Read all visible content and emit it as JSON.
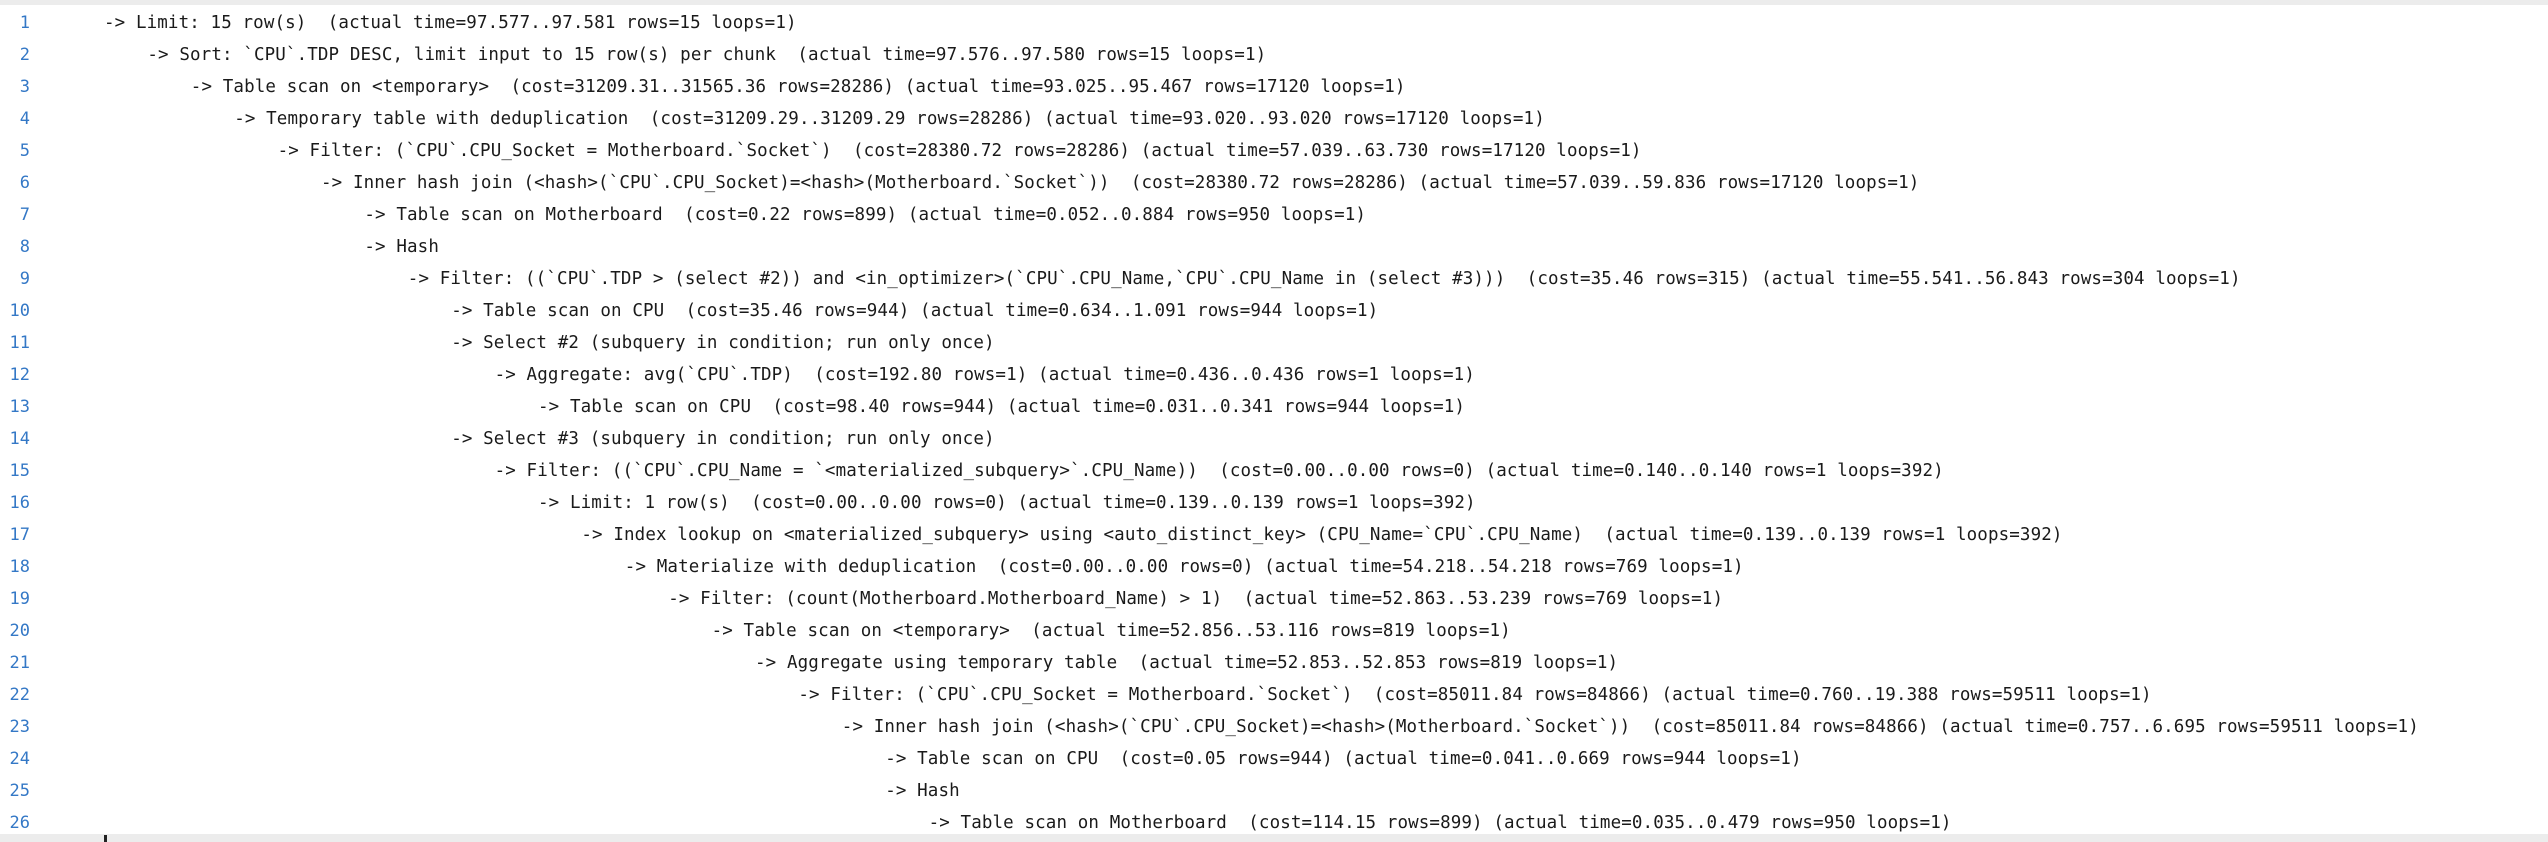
{
  "editor": {
    "lines": [
      {
        "number": "1",
        "indent": 0,
        "text": "-> Limit: 15 row(s)  (actual time=97.577..97.581 rows=15 loops=1)"
      },
      {
        "number": "2",
        "indent": 1,
        "text": "-> Sort: `CPU`.TDP DESC, limit input to 15 row(s) per chunk  (actual time=97.576..97.580 rows=15 loops=1)"
      },
      {
        "number": "3",
        "indent": 2,
        "text": "-> Table scan on <temporary>  (cost=31209.31..31565.36 rows=28286) (actual time=93.025..95.467 rows=17120 loops=1)"
      },
      {
        "number": "4",
        "indent": 3,
        "text": "-> Temporary table with deduplication  (cost=31209.29..31209.29 rows=28286) (actual time=93.020..93.020 rows=17120 loops=1)"
      },
      {
        "number": "5",
        "indent": 4,
        "text": "-> Filter: (`CPU`.CPU_Socket = Motherboard.`Socket`)  (cost=28380.72 rows=28286) (actual time=57.039..63.730 rows=17120 loops=1)"
      },
      {
        "number": "6",
        "indent": 5,
        "text": "-> Inner hash join (<hash>(`CPU`.CPU_Socket)=<hash>(Motherboard.`Socket`))  (cost=28380.72 rows=28286) (actual time=57.039..59.836 rows=17120 loops=1)"
      },
      {
        "number": "7",
        "indent": 6,
        "text": "-> Table scan on Motherboard  (cost=0.22 rows=899) (actual time=0.052..0.884 rows=950 loops=1)"
      },
      {
        "number": "8",
        "indent": 6,
        "text": "-> Hash"
      },
      {
        "number": "9",
        "indent": 7,
        "text": "-> Filter: ((`CPU`.TDP > (select #2)) and <in_optimizer>(`CPU`.CPU_Name,`CPU`.CPU_Name in (select #3)))  (cost=35.46 rows=315) (actual time=55.541..56.843 rows=304 loops=1)"
      },
      {
        "number": "10",
        "indent": 8,
        "text": "-> Table scan on CPU  (cost=35.46 rows=944) (actual time=0.634..1.091 rows=944 loops=1)"
      },
      {
        "number": "11",
        "indent": 8,
        "text": "-> Select #2 (subquery in condition; run only once)"
      },
      {
        "number": "12",
        "indent": 9,
        "text": "-> Aggregate: avg(`CPU`.TDP)  (cost=192.80 rows=1) (actual time=0.436..0.436 rows=1 loops=1)"
      },
      {
        "number": "13",
        "indent": 10,
        "text": "-> Table scan on CPU  (cost=98.40 rows=944) (actual time=0.031..0.341 rows=944 loops=1)"
      },
      {
        "number": "14",
        "indent": 8,
        "text": "-> Select #3 (subquery in condition; run only once)"
      },
      {
        "number": "15",
        "indent": 9,
        "text": "-> Filter: ((`CPU`.CPU_Name = `<materialized_subquery>`.CPU_Name))  (cost=0.00..0.00 rows=0) (actual time=0.140..0.140 rows=1 loops=392)"
      },
      {
        "number": "16",
        "indent": 10,
        "text": "-> Limit: 1 row(s)  (cost=0.00..0.00 rows=0) (actual time=0.139..0.139 rows=1 loops=392)"
      },
      {
        "number": "17",
        "indent": 11,
        "text": "-> Index lookup on <materialized_subquery> using <auto_distinct_key> (CPU_Name=`CPU`.CPU_Name)  (actual time=0.139..0.139 rows=1 loops=392)"
      },
      {
        "number": "18",
        "indent": 12,
        "text": "-> Materialize with deduplication  (cost=0.00..0.00 rows=0) (actual time=54.218..54.218 rows=769 loops=1)"
      },
      {
        "number": "19",
        "indent": 13,
        "text": "-> Filter: (count(Motherboard.Motherboard_Name) > 1)  (actual time=52.863..53.239 rows=769 loops=1)"
      },
      {
        "number": "20",
        "indent": 14,
        "text": "-> Table scan on <temporary>  (actual time=52.856..53.116 rows=819 loops=1)"
      },
      {
        "number": "21",
        "indent": 15,
        "text": "-> Aggregate using temporary table  (actual time=52.853..52.853 rows=819 loops=1)"
      },
      {
        "number": "22",
        "indent": 16,
        "text": "-> Filter: (`CPU`.CPU_Socket = Motherboard.`Socket`)  (cost=85011.84 rows=84866) (actual time=0.760..19.388 rows=59511 loops=1)"
      },
      {
        "number": "23",
        "indent": 17,
        "text": "-> Inner hash join (<hash>(`CPU`.CPU_Socket)=<hash>(Motherboard.`Socket`))  (cost=85011.84 rows=84866) (actual time=0.757..6.695 rows=59511 loops=1)"
      },
      {
        "number": "24",
        "indent": 18,
        "text": "-> Table scan on CPU  (cost=0.05 rows=944) (actual time=0.041..0.669 rows=944 loops=1)"
      },
      {
        "number": "25",
        "indent": 18,
        "text": "-> Hash"
      },
      {
        "number": "26",
        "indent": 19,
        "text": "-> Table scan on Motherboard  (cost=114.15 rows=899) (actual time=0.035..0.479 rows=950 loops=1)"
      }
    ]
  }
}
